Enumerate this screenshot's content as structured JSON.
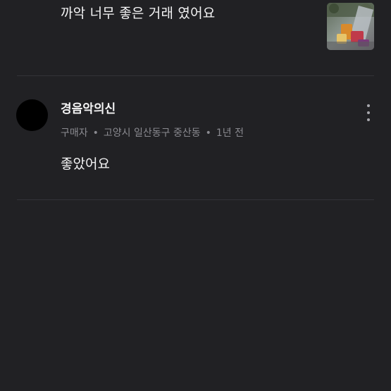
{
  "previous_review": {
    "text": "까악 너무 좋은 거래 였어요",
    "photo_icon": "review-photo-thumbnail"
  },
  "review": {
    "username": "경음악의신",
    "role": "구매자",
    "location": "고양시 일산동구 중산동",
    "time": "1년 전",
    "separator": "•",
    "body": "좋았어요",
    "more_icon": "more-vertical-icon"
  },
  "colors": {
    "background": "#212124",
    "divider": "#333338",
    "primary_text": "#f4f4f5",
    "secondary_text": "#8a8a90"
  }
}
